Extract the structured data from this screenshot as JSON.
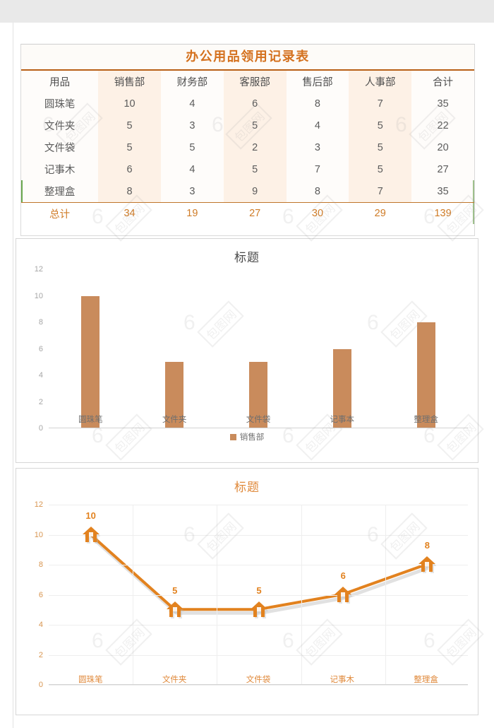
{
  "document": {
    "title": "办公用品领用记录表",
    "title_color": "#d4711e",
    "rule_color": "#b85f16"
  },
  "table": {
    "headers": [
      "用品",
      "销售部",
      "财务部",
      "客服部",
      "售后部",
      "人事部",
      "合计"
    ],
    "rows": [
      {
        "item": "圆珠笔",
        "values": [
          "10",
          "4",
          "6",
          "8",
          "7"
        ],
        "total": "35"
      },
      {
        "item": "文件夹",
        "values": [
          "5",
          "3",
          "5",
          "4",
          "5"
        ],
        "total": "22"
      },
      {
        "item": "文件袋",
        "values": [
          "5",
          "5",
          "2",
          "3",
          "5"
        ],
        "total": "20"
      },
      {
        "item": "记事木",
        "values": [
          "6",
          "4",
          "5",
          "7",
          "5"
        ],
        "total": "27"
      },
      {
        "item": "整理盒",
        "values": [
          "8",
          "3",
          "9",
          "8",
          "7"
        ],
        "total": "35"
      }
    ],
    "total_row": {
      "label": "总计",
      "values": [
        "34",
        "19",
        "27",
        "30",
        "29"
      ],
      "total": "139"
    },
    "tint_color": "#fdf1e6",
    "total_text_color": "#cf7b26",
    "accent_green": "#6aa84f"
  },
  "chart_data": [
    {
      "type": "bar",
      "title": "标题",
      "title_color": "#4a4a4a",
      "categories": [
        "圆珠笔",
        "文件夹",
        "文件袋",
        "记事本",
        "整理盒"
      ],
      "series": [
        {
          "name": "销售部",
          "values": [
            10,
            5,
            5,
            6,
            8
          ]
        }
      ],
      "legend": [
        "销售部"
      ],
      "legend_position": "bottom",
      "yticks": [
        0,
        2,
        4,
        6,
        8,
        10,
        12
      ],
      "ylim": [
        0,
        12
      ],
      "xlabel": "",
      "ylabel": "",
      "grid": false,
      "bar_color": "#c98b5c",
      "tick_color": "#a6a6a6"
    },
    {
      "type": "line",
      "title": "标题",
      "title_color": "#e08a3c",
      "categories": [
        "圆珠笔",
        "文件夹",
        "文件袋",
        "记事木",
        "整理盒"
      ],
      "series": [
        {
          "name": "销售部",
          "values": [
            10,
            5,
            5,
            6,
            8
          ]
        }
      ],
      "data_labels": [
        "10",
        "5",
        "5",
        "6",
        "8"
      ],
      "yticks": [
        0,
        2,
        4,
        6,
        8,
        10,
        12
      ],
      "ylim": [
        0,
        12
      ],
      "xlabel": "",
      "ylabel": "",
      "grid": true,
      "line_color": "#e2821f",
      "marker_shape": "house",
      "tick_color": "#d89550"
    }
  ],
  "watermark": {
    "text": "6",
    "label": "包图网"
  }
}
